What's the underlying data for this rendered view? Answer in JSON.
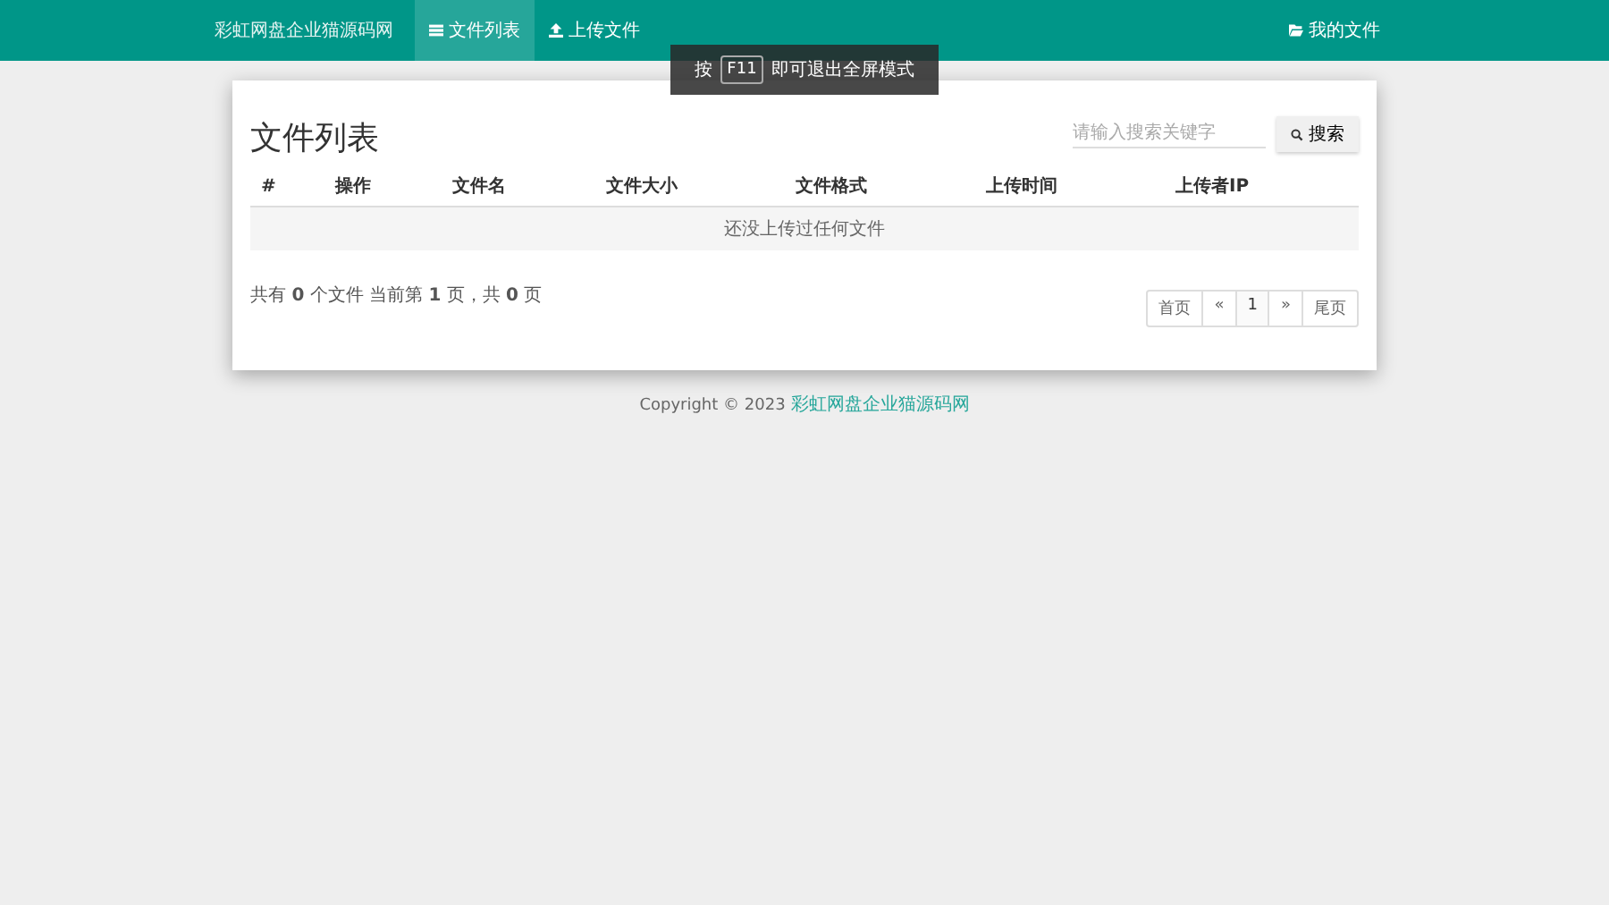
{
  "navbar": {
    "brand": "彩虹网盘企业猫源码网",
    "items": [
      {
        "label": "文件列表",
        "selected": true
      },
      {
        "label": "上传文件",
        "selected": false
      }
    ],
    "right_item": {
      "label": "我的文件"
    }
  },
  "toast": {
    "before": "按",
    "key": "F11",
    "after": "即可退出全屏模式"
  },
  "panel": {
    "title": "文件列表",
    "search": {
      "placeholder": "请输入搜索关键字",
      "button": "搜索"
    },
    "table": {
      "columns": [
        "#",
        "操作",
        "文件名",
        "文件大小",
        "文件格式",
        "上传时间",
        "上传者IP"
      ],
      "empty_message": "还没上传过任何文件"
    },
    "summary": "共有 **0** 个文件 当前第 **1** 页，共 **0** 页",
    "pagination": [
      {
        "label": "首页",
        "selected": false
      },
      {
        "label": "«",
        "selected": false
      },
      {
        "label": "1",
        "selected": true
      },
      {
        "label": "»",
        "selected": false
      },
      {
        "label": "尾页",
        "selected": false
      }
    ]
  },
  "footer": {
    "text": "Copyright © 2023",
    "link": "彩虹网盘企业猫源码网"
  }
}
